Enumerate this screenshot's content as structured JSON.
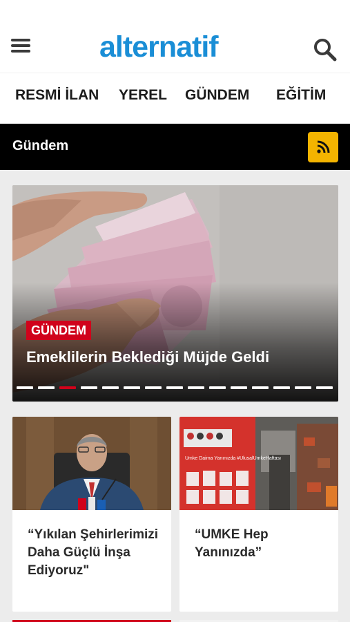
{
  "header": {
    "logo_text": "alternatif",
    "menu_icon": "hamburger-menu-icon",
    "search_icon": "search-icon"
  },
  "nav": {
    "items": [
      {
        "label": "RESMİ İLAN"
      },
      {
        "label": "YEREL"
      },
      {
        "label": "GÜNDEM"
      },
      {
        "label": "EĞİTİM"
      }
    ]
  },
  "section": {
    "title": "Gündem",
    "rss_icon": "rss-icon"
  },
  "slider": {
    "category": "GÜNDEM",
    "headline": "Emeklilerin Beklediği Müjde Geldi",
    "slide_count": 15,
    "active_index": 2
  },
  "cards": [
    {
      "title": "“Yıkılan Şehirlerimizi Daha Güçlü İnşa Ediyoruz\""
    },
    {
      "title": "“UMKE Hep Yanınızda”",
      "image_caption": "Umke Daima Yanınızda #UlusalUmkeHaftası"
    }
  ],
  "colors": {
    "brand": "#1a8ed6",
    "accent": "#d0021b",
    "rss": "#f4b400",
    "section_bar": "#000000"
  }
}
